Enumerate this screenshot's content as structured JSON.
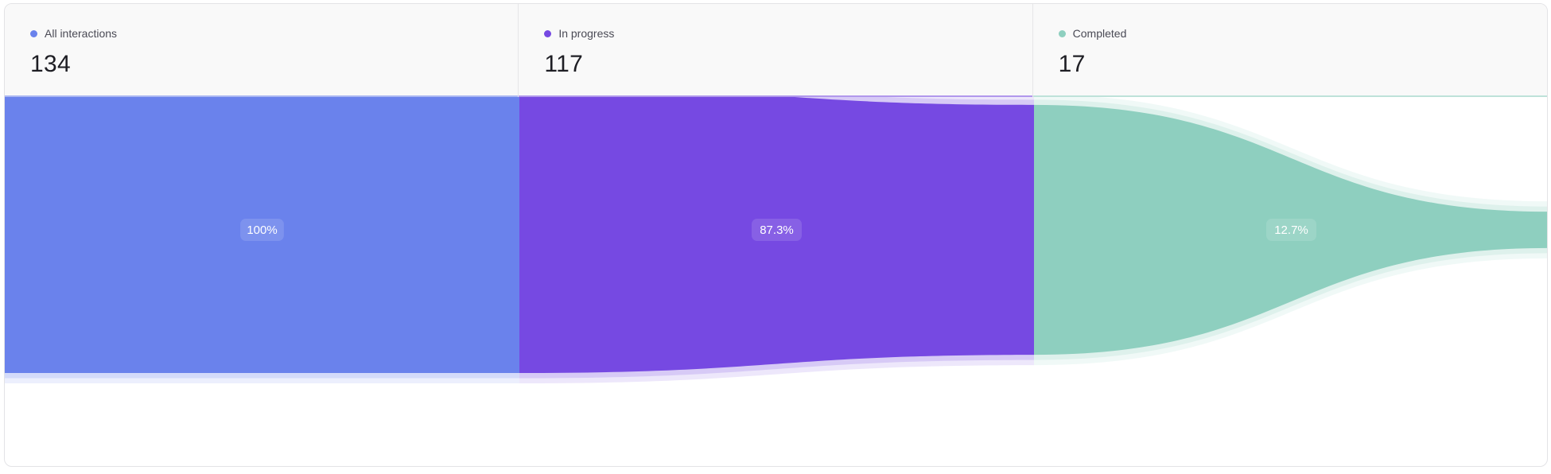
{
  "stages": [
    {
      "label": "All interactions",
      "value": "134",
      "color": "#6a82ec"
    },
    {
      "label": "In progress",
      "value": "117",
      "color": "#7649e2"
    },
    {
      "label": "Completed",
      "value": "17",
      "color": "#8ecfbf"
    }
  ],
  "chart_data": {
    "type": "funnel",
    "categories": [
      "All interactions",
      "In progress",
      "Completed"
    ],
    "values": [
      134,
      117,
      17
    ],
    "percent_labels": [
      "100%",
      "87.3%",
      "12.7%"
    ],
    "colors": [
      "#6a82ec",
      "#7649e2",
      "#8ecfbf"
    ]
  }
}
